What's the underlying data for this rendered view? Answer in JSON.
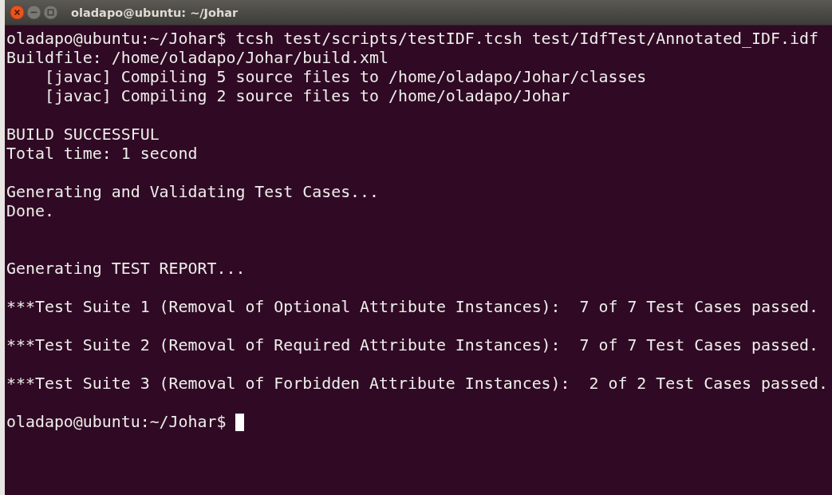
{
  "window": {
    "title": "oladapo@ubuntu: ~/Johar"
  },
  "terminal": {
    "lines": [
      {
        "kind": "text",
        "text": "oladapo@ubuntu:~/Johar$ tcsh test/scripts/testIDF.tcsh test/IdfTest/Annotated_IDF.idf"
      },
      {
        "kind": "text",
        "text": "Buildfile: /home/oladapo/Johar/build.xml"
      },
      {
        "kind": "text",
        "text": "    [javac] Compiling 5 source files to /home/oladapo/Johar/classes"
      },
      {
        "kind": "text",
        "text": "    [javac] Compiling 2 source files to /home/oladapo/Johar"
      },
      {
        "kind": "blank"
      },
      {
        "kind": "text",
        "text": "BUILD SUCCESSFUL"
      },
      {
        "kind": "text",
        "text": "Total time: 1 second"
      },
      {
        "kind": "blank"
      },
      {
        "kind": "text",
        "text": "Generating and Validating Test Cases..."
      },
      {
        "kind": "text",
        "text": "Done."
      },
      {
        "kind": "blank"
      },
      {
        "kind": "blank"
      },
      {
        "kind": "text",
        "text": "Generating TEST REPORT..."
      },
      {
        "kind": "blank"
      },
      {
        "kind": "text",
        "text": "***Test Suite 1 (Removal of Optional Attribute Instances):  7 of 7 Test Cases passed."
      },
      {
        "kind": "blank"
      },
      {
        "kind": "text",
        "text": "***Test Suite 2 (Removal of Required Attribute Instances):  7 of 7 Test Cases passed."
      },
      {
        "kind": "blank"
      },
      {
        "kind": "text",
        "text": "***Test Suite 3 (Removal of Forbidden Attribute Instances):  2 of 2 Test Cases passed."
      },
      {
        "kind": "blank"
      },
      {
        "kind": "prompt",
        "text": "oladapo@ubuntu:~/Johar$",
        "cursor": true
      }
    ]
  }
}
